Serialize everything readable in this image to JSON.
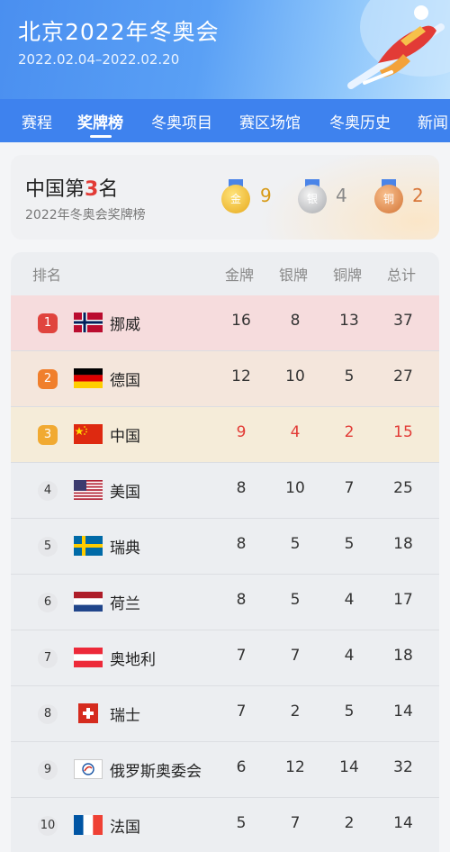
{
  "header": {
    "title": "北京2022年冬奥会",
    "dates": "2022.02.04–2022.02.20"
  },
  "tabs": [
    {
      "label": "赛程",
      "active": false
    },
    {
      "label": "奖牌榜",
      "active": true
    },
    {
      "label": "冬奥项目",
      "active": false
    },
    {
      "label": "赛区场馆",
      "active": false
    },
    {
      "label": "冬奥历史",
      "active": false
    },
    {
      "label": "新闻",
      "active": false
    }
  ],
  "summary": {
    "rank_prefix": "中国第",
    "rank_number": "3",
    "rank_suffix": "名",
    "subtitle": "2022年冬奥会奖牌榜",
    "gold_label": "金",
    "silver_label": "银",
    "bronze_label": "铜",
    "gold": "9",
    "silver": "4",
    "bronze": "2"
  },
  "table": {
    "headers": {
      "rank": "排名",
      "gold": "金牌",
      "silver": "银牌",
      "bronze": "铜牌",
      "total": "总计"
    },
    "rows": [
      {
        "rank": "1",
        "country": "挪威",
        "flag": "norway-flag",
        "gold": "16",
        "silver": "8",
        "bronze": "13",
        "total": "37"
      },
      {
        "rank": "2",
        "country": "德国",
        "flag": "germany-flag",
        "gold": "12",
        "silver": "10",
        "bronze": "5",
        "total": "27"
      },
      {
        "rank": "3",
        "country": "中国",
        "flag": "china-flag",
        "gold": "9",
        "silver": "4",
        "bronze": "2",
        "total": "15"
      },
      {
        "rank": "4",
        "country": "美国",
        "flag": "usa-flag",
        "gold": "8",
        "silver": "10",
        "bronze": "7",
        "total": "25"
      },
      {
        "rank": "5",
        "country": "瑞典",
        "flag": "sweden-flag",
        "gold": "8",
        "silver": "5",
        "bronze": "5",
        "total": "18"
      },
      {
        "rank": "6",
        "country": "荷兰",
        "flag": "netherlands-flag",
        "gold": "8",
        "silver": "5",
        "bronze": "4",
        "total": "17"
      },
      {
        "rank": "7",
        "country": "奥地利",
        "flag": "austria-flag",
        "gold": "7",
        "silver": "7",
        "bronze": "4",
        "total": "18"
      },
      {
        "rank": "8",
        "country": "瑞士",
        "flag": "switzerland-flag",
        "gold": "7",
        "silver": "2",
        "bronze": "5",
        "total": "14"
      },
      {
        "rank": "9",
        "country": "俄罗斯奥委会",
        "flag": "roc-flag",
        "gold": "6",
        "silver": "12",
        "bronze": "14",
        "total": "32"
      },
      {
        "rank": "10",
        "country": "法国",
        "flag": "france-flag",
        "gold": "5",
        "silver": "7",
        "bronze": "2",
        "total": "14"
      }
    ]
  },
  "colors": {
    "accent_blue": "#3e82ee",
    "highlight_red": "#e23b36",
    "rank1_badge": "#e0443e",
    "rank2_badge": "#f07f2c",
    "rank3_badge": "#f1aa32",
    "rank1_row": "#f6dcdd",
    "rank2_row": "#f4e6dc",
    "rank3_row": "#f5ecd9"
  }
}
